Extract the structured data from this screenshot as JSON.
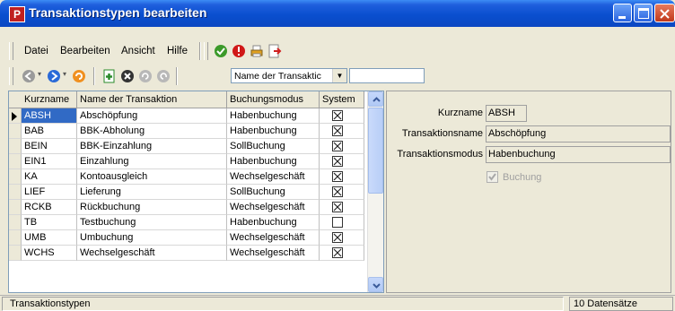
{
  "window": {
    "title": "Transaktionstypen bearbeiten",
    "app_icon_letter": "P"
  },
  "menu": {
    "items": [
      "Datei",
      "Bearbeiten",
      "Ansicht",
      "Hilfe"
    ]
  },
  "menu_toolbar_icons": [
    "check-icon",
    "exclamation-icon",
    "print-icon",
    "export-icon"
  ],
  "toolbar": {
    "icons": [
      "back-icon",
      "forward-icon",
      "reload-icon",
      "add-icon",
      "delete-icon",
      "undo-icon",
      "redo-icon"
    ],
    "field_select": "Name der Transaktic",
    "search_value": ""
  },
  "grid": {
    "columns": [
      "Kurzname",
      "Name der Transaktion",
      "Buchungsmodus",
      "System"
    ],
    "rows": [
      {
        "kurz": "ABSH",
        "name": "Abschöpfung",
        "modus": "Habenbuchung",
        "system": true,
        "selected": true
      },
      {
        "kurz": "BAB",
        "name": "BBK-Abholung",
        "modus": "Habenbuchung",
        "system": true
      },
      {
        "kurz": "BEIN",
        "name": "BBK-Einzahlung",
        "modus": "SollBuchung",
        "system": true
      },
      {
        "kurz": "EIN1",
        "name": "Einzahlung",
        "modus": "Habenbuchung",
        "system": true
      },
      {
        "kurz": "KA",
        "name": "Kontoausgleich",
        "modus": "Wechselgeschäft",
        "system": true
      },
      {
        "kurz": "LIEF",
        "name": "Lieferung",
        "modus": "SollBuchung",
        "system": true
      },
      {
        "kurz": "RCKB",
        "name": "Rückbuchung",
        "modus": "Wechselgeschäft",
        "system": true
      },
      {
        "kurz": "TB",
        "name": "Testbuchung",
        "modus": "Habenbuchung",
        "system": false
      },
      {
        "kurz": "UMB",
        "name": "Umbuchung",
        "modus": "Wechselgeschäft",
        "system": true
      },
      {
        "kurz": "WCHS",
        "name": "Wechselgeschäft",
        "modus": "Wechselgeschäft",
        "system": true
      }
    ]
  },
  "detail": {
    "kurzname_label": "Kurzname",
    "kurzname_value": "ABSH",
    "name_label": "Transaktionsname",
    "name_value": "Abschöpfung",
    "modus_label": "Transaktionsmodus",
    "modus_value": "Habenbuchung",
    "buchung_label": "Buchung",
    "buchung_checked": true
  },
  "status": {
    "left": "Transaktionstypen",
    "right": "10 Datensätze"
  },
  "colors": {
    "titlebar": "#0a4fcf",
    "window_bg": "#ece9d8",
    "selection": "#316ac5"
  }
}
